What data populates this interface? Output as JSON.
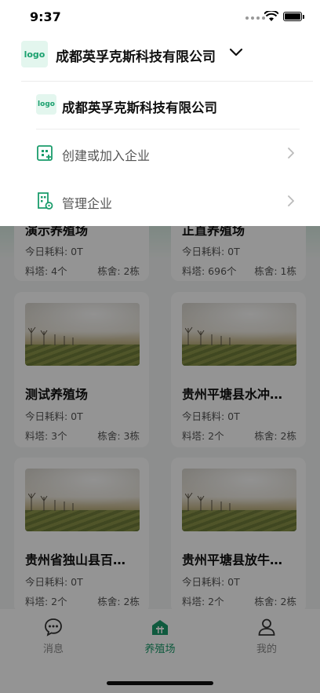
{
  "status_bar": {
    "time": "9:37"
  },
  "header": {
    "logo_text": "logo",
    "company_name": "成都英孚克斯科技有限公司"
  },
  "dropdown": {
    "current_company": {
      "logo_text": "logo",
      "name": "成都英孚克斯科技有限公司"
    },
    "items": [
      {
        "label": "创建或加入企业",
        "icon": "building-add-icon"
      },
      {
        "label": "管理企业",
        "icon": "building-manage-icon"
      }
    ]
  },
  "farms": [
    {
      "name": "演示养殖场",
      "consumption": "今日耗料: 0T",
      "towers": "料塔: 4个",
      "barns": "栋舍: 2栋"
    },
    {
      "name": "正直养殖场",
      "consumption": "今日耗料: 0T",
      "towers": "料塔: 696个",
      "barns": "栋舍: 1栋"
    },
    {
      "name": "测试养殖场",
      "consumption": "今日耗料: 0T",
      "towers": "料塔: 3个",
      "barns": "栋舍: 3栋"
    },
    {
      "name": "贵州平塘县水冲…",
      "consumption": "今日耗料: 0T",
      "towers": "料塔: 2个",
      "barns": "栋舍: 2栋"
    },
    {
      "name": "贵州省独山县百…",
      "consumption": "今日耗料: 0T",
      "towers": "料塔: 2个",
      "barns": "栋舍: 2栋"
    },
    {
      "name": "贵州平塘县放牛…",
      "consumption": "今日耗料: 0T",
      "towers": "料塔: 2个",
      "barns": "栋舍: 2栋"
    }
  ],
  "tabbar": {
    "tabs": [
      {
        "label": "消息",
        "icon": "message-icon",
        "active": false
      },
      {
        "label": "养殖场",
        "icon": "farm-icon",
        "active": true
      },
      {
        "label": "我的",
        "icon": "user-icon",
        "active": false
      }
    ]
  },
  "colors": {
    "accent": "#1a9c6b",
    "overlay": "rgba(0,0,0,0.42)"
  }
}
